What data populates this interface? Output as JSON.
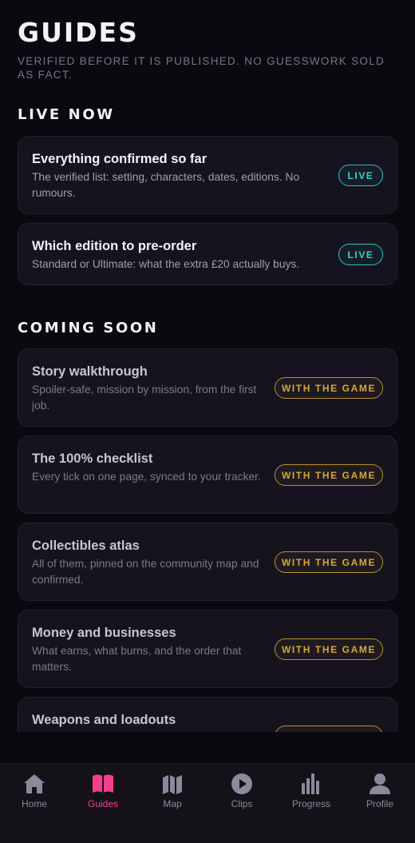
{
  "header": {
    "title": "GUIDES",
    "subtitle": "VERIFIED BEFORE IT IS PUBLISHED. NO GUESSWORK SOLD AS FACT."
  },
  "sections": {
    "live": {
      "title": "LIVE NOW",
      "cards": [
        {
          "title": "Everything confirmed so far",
          "desc": "The verified list: setting, characters, dates, editions. No rumours.",
          "badge": "LIVE"
        },
        {
          "title": "Which edition to pre-order",
          "desc": "Standard or Ultimate: what the extra £20 actually buys.",
          "badge": "LIVE"
        }
      ]
    },
    "soon": {
      "title": "COMING SOON",
      "cards": [
        {
          "title": "Story walkthrough",
          "desc": "Spoiler-safe, mission by mission, from the first job.",
          "badge": "WITH THE GAME"
        },
        {
          "title": "The 100% checklist",
          "desc": "Every tick on one page, synced to your tracker.",
          "badge": "WITH THE GAME"
        },
        {
          "title": "Collectibles atlas",
          "desc": "All of them, pinned on the community map and confirmed.",
          "badge": "WITH THE GAME"
        },
        {
          "title": "Money and businesses",
          "desc": "What earns, what burns, and the order that matters.",
          "badge": "WITH THE GAME"
        },
        {
          "title": "Weapons and loadouts",
          "desc": "",
          "badge": "WITH THE GAME"
        }
      ]
    }
  },
  "tabs": [
    {
      "label": "Home",
      "icon": "home-icon"
    },
    {
      "label": "Guides",
      "icon": "book-icon",
      "active": true
    },
    {
      "label": "Map",
      "icon": "map-icon"
    },
    {
      "label": "Clips",
      "icon": "play-icon"
    },
    {
      "label": "Progress",
      "icon": "bar-chart-icon"
    },
    {
      "label": "Profile",
      "icon": "user-icon"
    }
  ],
  "colors": {
    "background": "#0b0910",
    "card": "#16131f",
    "accent_active_tab": "#f43f8a",
    "live_badge": "#2bc5bb",
    "soon_badge": "#b8912c"
  }
}
